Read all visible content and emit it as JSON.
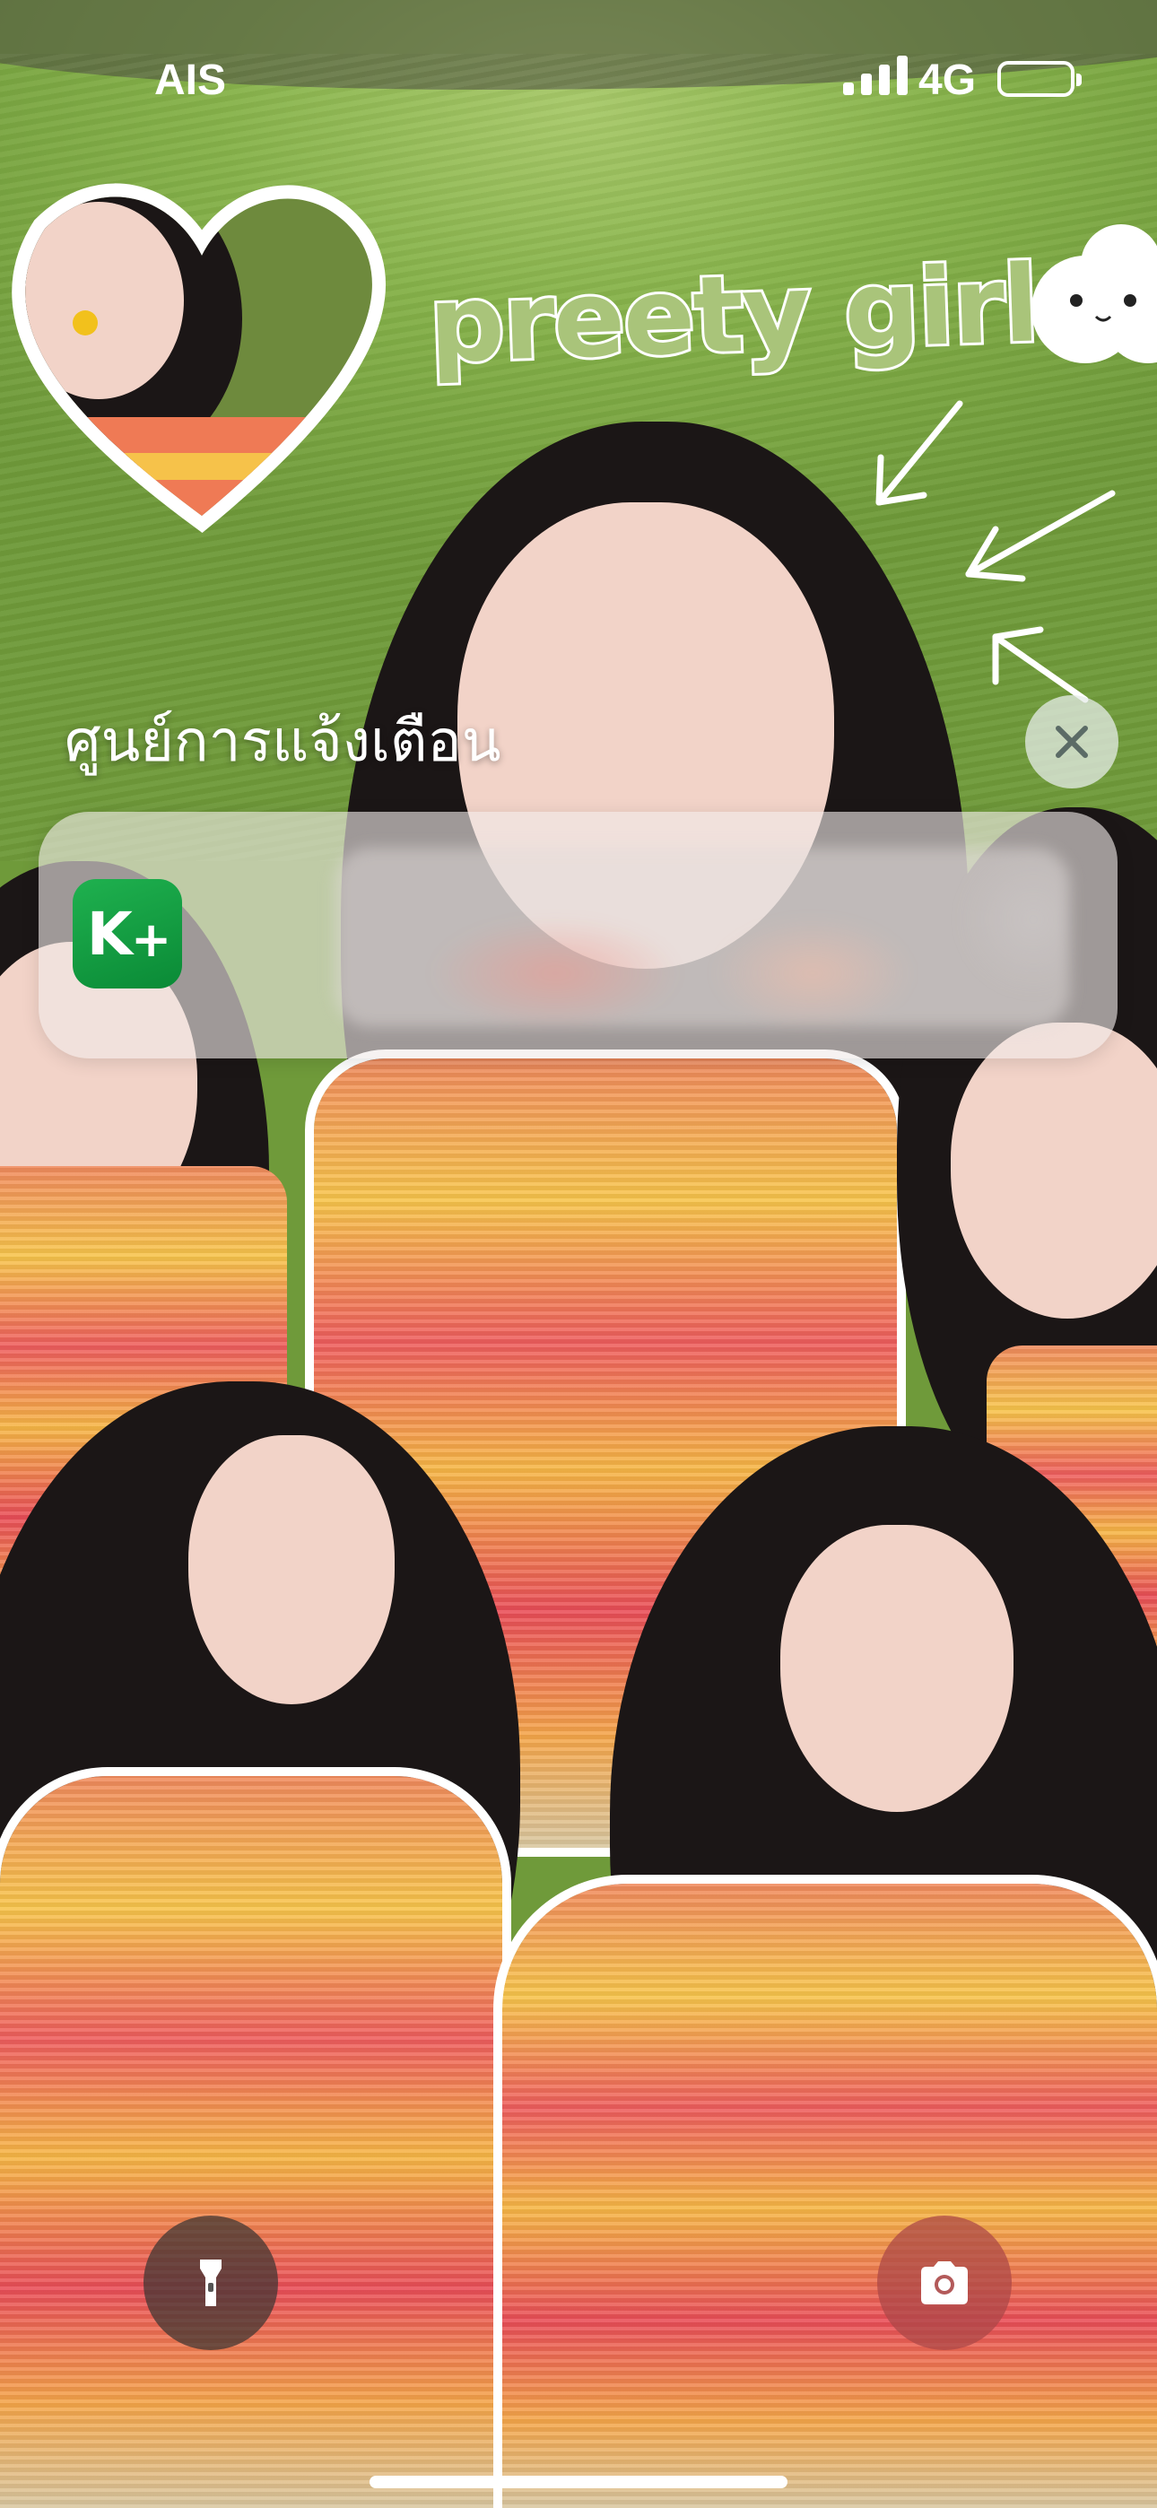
{
  "status_bar": {
    "carrier": "AIS",
    "network": "4G",
    "signal_icon": "cellular-signal-icon",
    "battery_icon": "battery-icon"
  },
  "wallpaper": {
    "sticker_text": "preety girls"
  },
  "notification_center": {
    "heading": "ศูนย์การแจ้งเตือน",
    "clear_icon": "close-icon",
    "notification": {
      "app_icon": "kplus-app-icon",
      "app_icon_text": "K",
      "app_icon_plus": "+",
      "content_blurred": true
    }
  },
  "lock_screen_controls": {
    "left_icon": "flashlight-icon",
    "right_icon": "camera-icon"
  },
  "colors": {
    "kplus_green": "#0a8a36",
    "grass": "#86b24a"
  }
}
